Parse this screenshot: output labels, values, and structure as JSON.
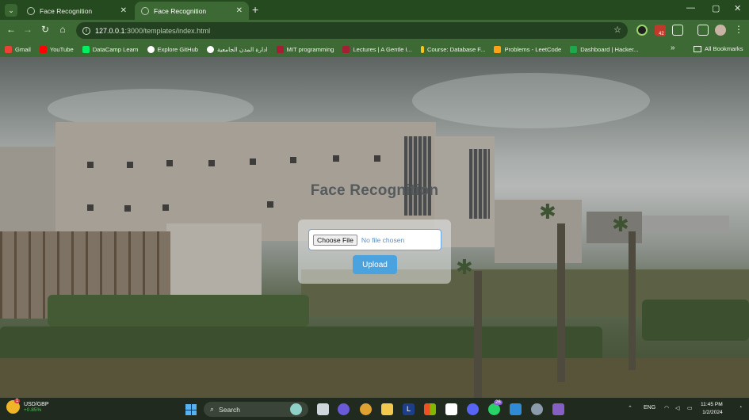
{
  "browser": {
    "tabs": [
      {
        "title": "Face Recognition",
        "active": false
      },
      {
        "title": "Face Recognition",
        "active": true
      }
    ],
    "new_tab_icon": "plus-icon",
    "window_controls": [
      "minimize-icon",
      "maximize-icon",
      "close-icon"
    ],
    "url": {
      "host": "127.0.0.1",
      "path": ":3000/templates/index.html"
    },
    "extension_badge": "42",
    "bookmarks": [
      {
        "label": "Gmail",
        "color": "#ea4335"
      },
      {
        "label": "YouTube",
        "color": "#ff0000"
      },
      {
        "label": "DataCamp Learn",
        "color": "#03ef62"
      },
      {
        "label": "Explore GitHub",
        "color": "#ffffff"
      },
      {
        "label": "ادارة المدن الجامعية",
        "color": "#ffffff"
      },
      {
        "label": "MIT programming",
        "color": "#a31f34"
      },
      {
        "label": "Lectures | A Gentle I...",
        "color": "#a31f34"
      },
      {
        "label": "Course: Database F...",
        "color": "#f5c518"
      },
      {
        "label": "Problems - LeetCode",
        "color": "#ffa116"
      },
      {
        "label": "Dashboard | Hacker...",
        "color": "#1ba94c"
      }
    ],
    "all_bookmarks_label": "All Bookmarks"
  },
  "page": {
    "heading": "Face Recognition",
    "file_button_label": "Choose File",
    "file_status": "No file chosen",
    "upload_label": "Upload",
    "accent_color": "#4aa3df"
  },
  "taskbar": {
    "weather_title": "USD/GBP",
    "weather_change": "+0.85%",
    "weather_badge": "1",
    "search_placeholder": "Search",
    "whatsapp_badge": "26",
    "language": "ENG",
    "time": "11:45 PM",
    "date": "1/2/2024"
  }
}
